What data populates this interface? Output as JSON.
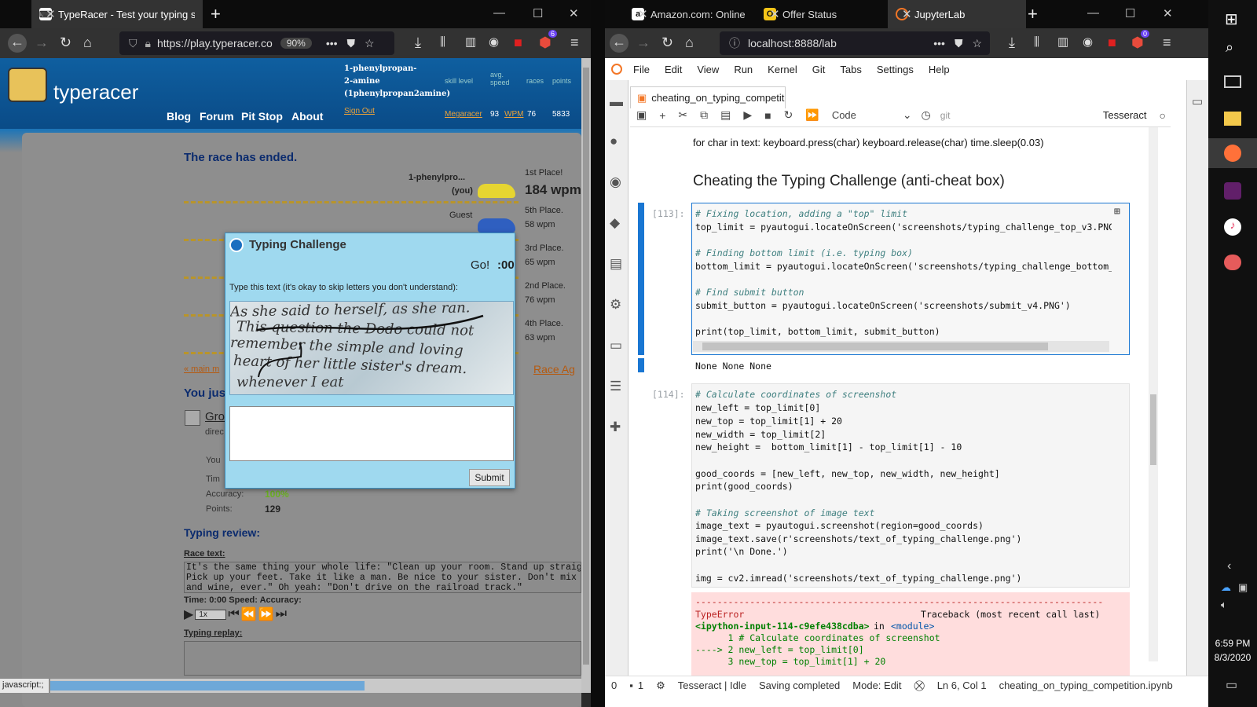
{
  "left_browser": {
    "tab_title": "TypeRacer - Test your typing sp",
    "url": "https://play.typeracer.co",
    "zoom": "90%",
    "addon_badge": "6",
    "status_text": "javascript:;"
  },
  "typeracer": {
    "logo": "typeracer",
    "nav": [
      "Blog",
      "Forum",
      "Pit Stop",
      "About"
    ],
    "user_line1": "1-phenylpropan-",
    "user_line2": "2-amine",
    "user_line3": "(1phenylpropan2amine)",
    "sign_out": "Sign Out",
    "stat_headers": [
      "skill level",
      "avg. speed",
      "races",
      "points"
    ],
    "stat_values": [
      "Megaracer",
      "93",
      "WPM",
      "76",
      "5833"
    ],
    "race_ended": "The race has ended.",
    "racers": [
      {
        "name": "1-phenylpro...",
        "sub": "(you)",
        "place": "1st Place!",
        "wpm": "184 wpm"
      },
      {
        "name": "Guest",
        "sub": "",
        "place": "5th Place.",
        "wpm": "58 wpm"
      },
      {
        "name": "",
        "sub": "",
        "place": "3rd Place.",
        "wpm": "65 wpm"
      },
      {
        "name": "",
        "sub": "",
        "place": "2nd Place.",
        "wpm": "76 wpm"
      },
      {
        "name": "",
        "sub": "",
        "place": "4th Place.",
        "wpm": "63 wpm"
      }
    ],
    "main_menu": "« main m",
    "race_again": "Race Ag",
    "you_just": "You jus",
    "gro": "Gro",
    "direc": "direc",
    "your": "You",
    "time": "Tim",
    "accuracy_label": "Accuracy:",
    "accuracy_value": "100%",
    "points_label": "Points:",
    "points_value": "129",
    "typing_review": "Typing review:",
    "race_text_label": "Race text:",
    "race_text": "It's the same thing your whole life: \"Clean up your room. Stand up straig\nPick up your feet. Take it like a man. Be nice to your sister. Don't mix\nand wine, ever.\" Oh yeah: \"Don't drive on the railroad track.\"",
    "time_speed": "Time: 0:00 Speed:   Accuracy:",
    "speed_select": "1x",
    "typing_replay": "Typing replay:"
  },
  "modal": {
    "title": "Typing Challenge",
    "go": "Go!",
    "timer": ":00",
    "instructions": "Type this text (it's okay to skip letters you don't understand):",
    "captcha_lines": [
      "As she said to herself, as she ran.",
      "This question the Dodo could not",
      "remember the simple and loving",
      "heart of her little sister's dream.",
      "whenever I eat"
    ],
    "submit": "Submit"
  },
  "right_browser": {
    "tabs": [
      {
        "title": "Amazon.com: Online",
        "icon": "a"
      },
      {
        "title": "Offer Status",
        "icon": "O"
      },
      {
        "title": "JupyterLab",
        "icon": "jupyter"
      }
    ],
    "url": "localhost:8888/lab",
    "addon_badge": "0"
  },
  "jupyter": {
    "menu": [
      "File",
      "Edit",
      "View",
      "Run",
      "Kernel",
      "Git",
      "Tabs",
      "Settings",
      "Help"
    ],
    "doc_tab": "cheating_on_typing_competit",
    "cell_type": "Code",
    "git_label": "git",
    "kernel": "Tesseract",
    "prev_output": "for char in text: keyboard.press(char) keyboard.release(char) time.sleep(0.03)",
    "heading": "Cheating the Typing Challenge (anti-cheat box)",
    "cell1_prompt": "[113]:",
    "cell1_lines": [
      "# Fixing location, adding a \"top\" limit",
      "top_limit = pyautogui.locateOnScreen('screenshots/typing_challenge_top_v3.PNG",
      "",
      "# Finding bottom limit (i.e. typing box)",
      "bottom_limit = pyautogui.locateOnScreen('screenshots/typing_challenge_bottom_",
      "",
      "# Find submit button",
      "submit_button = pyautogui.locateOnScreen('screenshots/submit_v4.PNG')",
      "",
      "print(top_limit, bottom_limit, submit_button)"
    ],
    "cell1_output": "None None None",
    "cell2_prompt": "[114]:",
    "cell2_lines": [
      "# Calculate coordinates of screenshot",
      "new_left = top_limit[0]",
      "new_top = top_limit[1] + 20",
      "new_width = top_limit[2]",
      "new_height =  bottom_limit[1] - top_limit[1] - 10",
      "",
      "good_coords = [new_left, new_top, new_width, new_height]",
      "print(good_coords)",
      "",
      "# Taking screenshot of image text",
      "image_text = pyautogui.screenshot(region=good_coords)",
      "image_text.save(r'screenshots/text_of_typing_challenge.png')",
      "print('\\n Done.')",
      "",
      "img = cv2.imread('screenshots/text_of_typing_challenge.png')"
    ],
    "error_rule": "---------------------------------------------------------------------------",
    "error_type": "TypeError",
    "error_traceback": "Traceback (most recent call last)",
    "error_input": "<ipython-input-114-c9efe438cdba>",
    "error_in": "in",
    "error_module": "<module>",
    "error_lines": [
      "      1 # Calculate coordinates of screenshot",
      "----> 2 new_left = top_limit[0]",
      "      3 new_top = top_limit[1] + 20"
    ],
    "status": {
      "zero": "0",
      "one": "1",
      "kernel_status": "Tesseract | Idle",
      "saving": "Saving completed",
      "mode": "Mode: Edit",
      "pos": "Ln 6, Col 1",
      "file": "cheating_on_typing_competition.ipynb"
    }
  },
  "taskbar": {
    "time": "6:59 PM",
    "date": "8/3/2020"
  }
}
